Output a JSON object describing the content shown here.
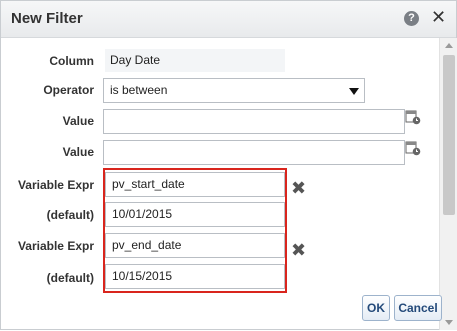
{
  "dialog": {
    "title": "New Filter",
    "help_icon": "question-mark-icon",
    "help_glyph": "?",
    "close_icon": "close-icon",
    "close_glyph": "✕"
  },
  "form": {
    "column": {
      "label": "Column",
      "value": "Day Date"
    },
    "operator": {
      "label": "Operator",
      "value": "is between"
    },
    "value1": {
      "label": "Value",
      "value": ""
    },
    "value2": {
      "label": "Value",
      "value": ""
    },
    "variable1": {
      "label": "Variable Expr",
      "value": "pv_start_date"
    },
    "default1": {
      "label": "(default)",
      "value": "10/01/2015"
    },
    "variable2": {
      "label": "Variable Expr",
      "value": "pv_end_date"
    },
    "default2": {
      "label": "(default)",
      "value": "10/15/2015"
    },
    "remove_glyph": "✖"
  },
  "buttons": {
    "ok": "OK",
    "cancel": "Cancel"
  },
  "colors": {
    "highlight": "#d9251d",
    "button_text": "#244a7a"
  }
}
